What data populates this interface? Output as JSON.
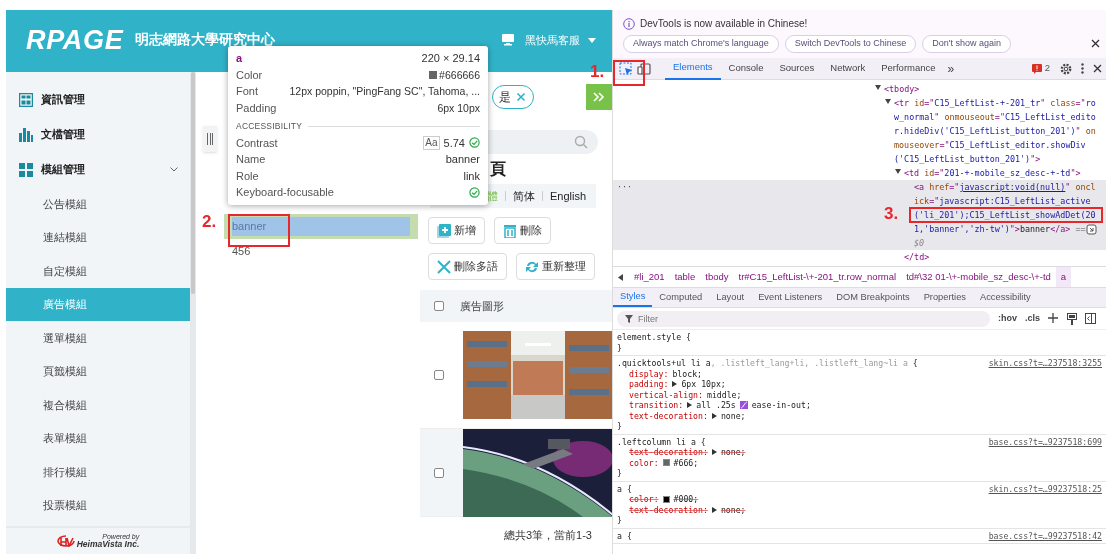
{
  "header": {
    "logo": "RPAGE",
    "site_name": "明志網路大學研究中心",
    "user": "黑快馬客服"
  },
  "sidebar": {
    "groups": [
      {
        "label": "資訊管理",
        "kind": "panel",
        "expanded": false
      },
      {
        "label": "文檔管理",
        "kind": "bars",
        "expanded": false
      },
      {
        "label": "模組管理",
        "kind": "tiles",
        "expanded": true,
        "children": [
          {
            "label": "公告模組",
            "selected": false
          },
          {
            "label": "連結模組",
            "selected": false
          },
          {
            "label": "自定模組",
            "selected": false
          },
          {
            "label": "廣告模組",
            "selected": true
          },
          {
            "label": "選單模組",
            "selected": false
          },
          {
            "label": "頁籤模組",
            "selected": false
          },
          {
            "label": "複合模組",
            "selected": false
          },
          {
            "label": "表單模組",
            "selected": false
          },
          {
            "label": "排行模組",
            "selected": false
          },
          {
            "label": "投票模組",
            "selected": false
          }
        ]
      }
    ],
    "footer": {
      "powered_by": "Powered by",
      "company": "HeimaVista Inc."
    }
  },
  "list": {
    "items": [
      {
        "label": "banner",
        "inspected": true
      },
      {
        "label": "456",
        "inspected": false
      }
    ]
  },
  "content": {
    "chip": {
      "label": "是"
    },
    "title": "頁",
    "languages": [
      {
        "label": "體",
        "selected": true
      },
      {
        "label": "简体",
        "selected": false
      },
      {
        "label": "English",
        "selected": false
      }
    ],
    "buttons": [
      {
        "label": "新增",
        "kind": "add"
      },
      {
        "label": "刪除",
        "kind": "trash"
      },
      {
        "label": "刪除多語",
        "kind": "cross"
      },
      {
        "label": "重新整理",
        "kind": "refresh"
      }
    ],
    "table": {
      "select_all": {
        "checked": false
      },
      "column": "廣告圖形",
      "rows": [
        {
          "checked": false
        },
        {
          "checked": false
        }
      ]
    },
    "footer": "總共3筆，當前1-3"
  },
  "tooltip": {
    "tag": "a",
    "size": "220 × 29.14",
    "rows": [
      {
        "label": "Color",
        "value": "#666666",
        "color": "#666666"
      },
      {
        "label": "Font",
        "value": "12px poppin, \"PingFang SC\", Tahoma, ..."
      },
      {
        "label": "Padding",
        "value": "6px 10px"
      }
    ],
    "section": "ACCESSIBILITY",
    "a11y": [
      {
        "label": "Contrast",
        "badge": "Aa",
        "value": "5.74",
        "pass": true
      },
      {
        "label": "Name",
        "value": "banner"
      },
      {
        "label": "Role",
        "value": "link"
      },
      {
        "label": "Keyboard-focusable",
        "pass": true
      }
    ]
  },
  "devtools": {
    "infobar": {
      "message": "DevTools is now available in Chinese!",
      "buttons": [
        "Always match Chrome's language",
        "Switch DevTools to Chinese",
        "Don't show again"
      ]
    },
    "inspect_selected": true,
    "tabs": [
      {
        "label": "Elements",
        "selected": true
      },
      {
        "label": "Console",
        "selected": false
      },
      {
        "label": "Sources",
        "selected": false
      },
      {
        "label": "Network",
        "selected": false
      },
      {
        "label": "Performance",
        "selected": false
      }
    ],
    "more": "»",
    "issues": "2",
    "tree": [
      {
        "expanded": true,
        "open": [
          {
            "kind": "tag",
            "t": "<tbody>"
          }
        ],
        "children": [
          {
            "expanded": true,
            "open": [
              {
                "kind": "tag",
                "t": "<tr "
              },
              {
                "kind": "attr",
                "t": "id"
              },
              {
                "kind": "tag",
                "t": "=\""
              },
              {
                "kind": "val",
                "t": "C15_LeftList-+-201_tr"
              },
              {
                "kind": "tag",
                "t": "\" "
              },
              {
                "kind": "attr",
                "t": "class"
              },
              {
                "kind": "tag",
                "t": "=\""
              },
              {
                "kind": "val",
                "t": "row_normal"
              },
              {
                "kind": "tag",
                "t": "\" "
              },
              {
                "kind": "attr",
                "t": "onmouseout"
              },
              {
                "kind": "tag",
                "t": "=\""
              },
              {
                "kind": "val",
                "t": "C15_LeftList_editor.hideDiv('C15_LeftList_button_201')"
              },
              {
                "kind": "tag",
                "t": "\" "
              },
              {
                "kind": "attr",
                "t": "onmouseover"
              },
              {
                "kind": "tag",
                "t": "=\""
              },
              {
                "kind": "val",
                "t": "C15_LeftList_editor.showDiv('C15_LeftList_button_201')"
              },
              {
                "kind": "tag",
                "t": "\">"
              }
            ],
            "children": [
              {
                "expanded": true,
                "open": [
                  {
                    "kind": "tag",
                    "t": "<td "
                  },
                  {
                    "kind": "attr",
                    "t": "id"
                  },
                  {
                    "kind": "tag",
                    "t": "=\""
                  },
                  {
                    "kind": "val",
                    "t": "201-+-mobile_sz_desc-+-td"
                  },
                  {
                    "kind": "tag",
                    "t": "\">"
                  }
                ],
                "children": [
                  {
                    "selected": true,
                    "gutter": "···",
                    "open": [
                      {
                        "kind": "tag",
                        "t": "<a "
                      },
                      {
                        "kind": "attr",
                        "t": "href"
                      },
                      {
                        "kind": "tag",
                        "t": "=\""
                      },
                      {
                        "kind": "link",
                        "t": "javascript:void(null)"
                      },
                      {
                        "kind": "tag",
                        "t": "\" "
                      },
                      {
                        "kind": "attr",
                        "t": "onclick"
                      },
                      {
                        "kind": "tag",
                        "t": "=\""
                      },
                      {
                        "kind": "val",
                        "t": "javascript:C15_LeftList_active('li_201');C15_LeftList_showAdDet(201,'banner','zh-tw')"
                      },
                      {
                        "kind": "tag",
                        "t": "\">"
                      },
                      {
                        "kind": "text",
                        "t": "banner"
                      },
                      {
                        "kind": "tag",
                        "t": "</a>"
                      },
                      {
                        "kind": "ref",
                        "t": " == $0"
                      }
                    ]
                  }
                ],
                "close": [
                  {
                    "kind": "tag",
                    "t": "</td>"
                  }
                ]
              }
            ]
          }
        ]
      }
    ],
    "breadcrumbs": [
      {
        "label": "#li_201",
        "selected": false
      },
      {
        "label": "table",
        "selected": false
      },
      {
        "label": "tbody",
        "selected": false
      },
      {
        "label": "tr#C15_LeftList-\\+-201_tr.row_normal",
        "selected": false
      },
      {
        "label": "td#\\32 01-\\+-mobile_sz_desc-\\+-td",
        "selected": false
      },
      {
        "label": "a",
        "selected": true
      }
    ],
    "pane_tabs": [
      {
        "label": "Styles",
        "selected": true
      },
      {
        "label": "Computed",
        "selected": false
      },
      {
        "label": "Layout",
        "selected": false
      },
      {
        "label": "Event Listeners",
        "selected": false
      },
      {
        "label": "DOM Breakpoints",
        "selected": false
      },
      {
        "label": "Properties",
        "selected": false
      },
      {
        "label": "Accessibility",
        "selected": false
      }
    ],
    "filter": {
      "placeholder": "Filter"
    },
    "hov": ":hov",
    "cls": ".cls",
    "rules": [
      {
        "selector": [
          {
            "t": "element.style",
            "match": true
          }
        ],
        "brace": "{",
        "close": "}"
      },
      {
        "selector": [
          {
            "t": ".quicktools+ul li a",
            "match": true
          },
          {
            "t": ", .listleft_lang+li, .listleft_lang~li a",
            "match": false
          }
        ],
        "brace": "{",
        "close": "}",
        "source": "skin.css?t=…237518:3255",
        "props": [
          {
            "name": "display:",
            "value": "block;",
            "overridden": false,
            "expandable": false
          },
          {
            "name": "padding:",
            "value": "6px 10px;",
            "overridden": false,
            "expandable": true
          },
          {
            "name": "vertical-align:",
            "value": "middle;",
            "overridden": false,
            "expandable": false
          },
          {
            "name": "transition:",
            "value": "all .25s",
            "easing": "ease-in-out;",
            "overridden": false,
            "expandable": true
          },
          {
            "name": "text-decoration:",
            "value": "none;",
            "overridden": false,
            "expandable": true
          }
        ]
      },
      {
        "selector": [
          {
            "t": ".leftcolumn li a",
            "match": true
          }
        ],
        "brace": "{",
        "close": "}",
        "source": "base.css?t=…9237518:699",
        "props": [
          {
            "name": "text-decoration:",
            "value": "none;",
            "overridden": true,
            "expandable": true
          },
          {
            "name": "color:",
            "value": "#666;",
            "color": "#666666",
            "overridden": false,
            "expandable": false
          }
        ]
      },
      {
        "selector": [
          {
            "t": "a",
            "match": true
          }
        ],
        "brace": "{",
        "close": "}",
        "source": "skin.css?t=…99237518:25",
        "props": [
          {
            "name": "color:",
            "value": "#000;",
            "color": "#000000",
            "overridden": true,
            "expandable": false
          },
          {
            "name": "text-decoration:",
            "value": "none;",
            "overridden": true,
            "expandable": true
          }
        ]
      },
      {
        "selector": [
          {
            "t": "a",
            "match": true
          }
        ],
        "brace": "{",
        "source": "base.css?t=…99237518:42"
      }
    ]
  },
  "annotations": [
    {
      "label": "1."
    },
    {
      "label": "2."
    },
    {
      "label": "3."
    }
  ]
}
